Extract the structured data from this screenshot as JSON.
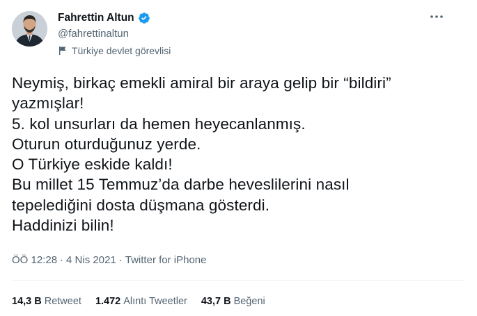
{
  "author": {
    "display_name": "Fahrettin Altun",
    "handle": "@fahrettinaltun",
    "label": "Türkiye devlet görevlisi",
    "verified_color": "#1d9bf0"
  },
  "tweet": {
    "lines": [
      "Neymiş, birkaç emekli amiral bir araya gelip bir “bildiri”",
      "yazmışlar!",
      "5. kol unsurları da hemen heyecanlanmış.",
      "Oturun oturduğunuz yerde.",
      "O Türkiye eskide kaldı!",
      "Bu millet 15 Temmuz’da darbe heveslilerini nasıl",
      "tepelediğini dosta düşmana gösterdi.",
      "Haddinizi bilin!"
    ]
  },
  "meta": {
    "time": "ÖÖ 12:28",
    "separator": "·",
    "date": "4 Nis 2021",
    "source": "Twitter for iPhone"
  },
  "stats": {
    "retweets_count": "14,3 B",
    "retweets_label": "Retweet",
    "quotes_count": "1.472",
    "quotes_label": "Alıntı Tweetler",
    "likes_count": "43,7 B",
    "likes_label": "Beğeni"
  },
  "icons": {
    "verified": "verified-badge-icon",
    "government_label": "flag-icon",
    "more": "more-options-icon"
  }
}
